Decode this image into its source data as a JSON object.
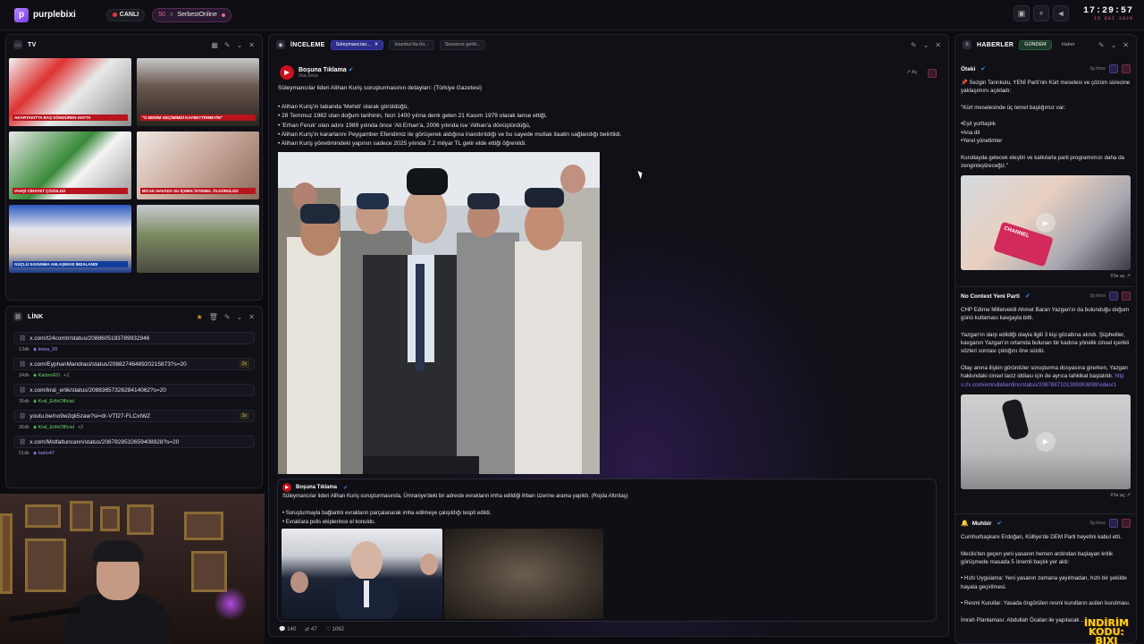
{
  "topbar": {
    "logo_letter": "p",
    "app_name": "purplebixi",
    "live_label": "CANLI",
    "viewer_count": "50",
    "user_status": "SerbestOnline",
    "clock_time": "17:29:57",
    "clock_date": "15 EKİ 2026"
  },
  "tv_panel": {
    "title": "TV",
    "tiles": [
      {
        "caption": "AKARYAKITTA BAŞ DÖNDÜREN HAFTA",
        "tone": "red"
      },
      {
        "caption": "\"O BENİM GEÇİMİMDİ KAYBETTİRMEYİN\"",
        "tone": "red"
      },
      {
        "caption": "VAHŞİ CİNAYET ÇÖZÜLDÜ",
        "tone": "red"
      },
      {
        "caption": "BİCAK HAVADA SU İÇMEK İSTEMEL ÖLDÜRÜLDÜ",
        "tone": "red"
      },
      {
        "caption": "GÜÇLÜ SAVUNMA ANLAŞMASI İMZALANDI",
        "tone": "blue"
      },
      {
        "caption": "",
        "tone": "none"
      }
    ]
  },
  "link_panel": {
    "title": "LİNK",
    "items": [
      {
        "url": "x.com/t24comtr/status/2088605183789932946",
        "age": "13dk",
        "user": "leiwa_00",
        "extra": "",
        "badge": ""
      },
      {
        "url": "x.com/EyphanMandraci/status/2088274648920215873?s=20",
        "age": "34dk",
        "user": "KaizenED",
        "extra": "+2",
        "badge": "2x"
      },
      {
        "url": "x.com/kral_erlik/status/2088365732628414062?s=20",
        "age": "35dk",
        "user": "Kral_ErlikOfficial",
        "extra": "",
        "badge": ""
      },
      {
        "url": "youtu.be/no9w2qk5zaw?si=dr-VTf27-FLCxIWZ",
        "age": "36dk",
        "user": "Kral_ErlikOfficial",
        "extra": "+2",
        "badge": "2x"
      },
      {
        "url": "x.com/Mstfaltuncann/status/2087828532659408928?s=20",
        "age": "51dk",
        "user": "baho47",
        "extra": "",
        "badge": ""
      }
    ]
  },
  "inceleme_panel": {
    "title": "İNCELEME",
    "tabs": [
      {
        "label": "Süleymancılar...",
        "active": true
      },
      {
        "label": "İstanbul'da bir...",
        "active": false
      },
      {
        "label": "Sessizce geldi...",
        "active": false
      }
    ],
    "post": {
      "author": "Boşuna Tıklama",
      "time": "3sa önce",
      "open_label": "Aç",
      "text": "Süleymancılar lideri Alihan Kuriş soruşturmasının detayları: (Türkiye Gazetesi)\n\n• Alihan Kuriş'in tabanda 'Mehdi' olarak görüldüğü,\n• 28 Temmuz 1982 olan doğum tarihinin, hicri 1400 yılına denk gelen 21 Kasım 1979 olarak lanse ettiği,\n• 'Erhan Feruk' olan adını 1989 yılında önce 'Ali Erhan'a, 2006 yılında ise 'Alihan'a dönüştürdüğü,\n• Alihan Kuriş'in kararlarını Peygamber Efendimiz ile görüşerek aldığına inandırıldığı ve bu sayede mutlak itaatin sağlandığı belirtildi.\n• Alihan Kuriş yönetimindeki yapının sadece 2025 yılında 7.2 milyar TL gelir elde ettiği öğrenildi."
    },
    "quote": {
      "author": "Boşuna Tıklama",
      "text": "Süleymancılar lideri Alihan Kuriş soruşturmasında, Ümraniye'deki bir adreste evrakların imha edildiği ihbarı üzerine arama yapıldı. (Rojda Altıntaş)\n\n• Soruşturmayla bağlantılı evrakların parçalanarak imha edilmeye çalışıldığı tespit edildi.\n• Evraklara polis ekiplerince el konuldu."
    },
    "stats": {
      "replies": "140",
      "reposts": "47",
      "likes": "1062"
    }
  },
  "haberler_panel": {
    "title": "HABERLER",
    "tabs": [
      {
        "label": "GÜNDEM",
        "active": true
      },
      {
        "label": "Haber",
        "active": false
      }
    ],
    "items": [
      {
        "author": "Öteki",
        "ago": "3g önce",
        "text": "📌 Sezgin Tanrıkulu, YENİ Parti'nin Kürt meselesi ve çözüm sürecine yaklaşımını açıkladı:\n\n\"Kürt meselesinde üç temel başlığımız var:\n\n•Eşit yurttaşlık\n•Ana dil\n•Yerel yönetimler\n\nKurultayda gelecek eleştiri ve katkılarla parti programımızı daha da zenginleştireceğiz.\"",
        "xlink": "X'te aç ↗",
        "media_label": "CHANNEL"
      },
      {
        "author": "No Context Yeni Parti",
        "ago": "3g önce",
        "text": "CHP Edirne Milletvekili Ahmet Baran Yazgan'ın da bulunduğu doğum günü kutlaması kavgayla bitti.\n\nYazgan'ın darp edildiği olayla ilgili 3 kişi gözaltına alındı. Şüpheliler, kavganın Yazgan'ın ortamda bulunan bir kadına yönelik cinsel içerikli sözleri sonrası çıktığını öne sürdü.\n\nOlay anına ilişkin görüntüler soruşturma dosyasına girerken, Yazgan hakkındaki cinsel taciz iddiası için de ayrıca tahkikat başlatıldı.",
        "link": "https://x.com/emrullaherdinc/status/2087887101308063898/video/1",
        "xlink": "X'te aç ↗"
      },
      {
        "author": "Muhbir",
        "ago": "3g önce",
        "text": "Cumhurbaşkanı Erdoğan, Külliye'de DEM Parti heyetini kabul etti.\n\nMeclis'ten geçen yeni yasanın hemen ardından başlayan kritik görüşmede masada 5 önemli başlık yer aldı:\n\n• Hızlı Uygulama: Yeni yasanın zamana yayılmadan, hızlı bir şekilde hayata geçirilmesi.\n\n• Resmi Kurullar: Yasada öngörülen resmi kurulların acilen kurulması.\n\nİmrah Planlaması: Abdullah Öcalan ile yapılacak ..."
      }
    ]
  },
  "promo": {
    "line1": "İNDİRİM KODU:",
    "line2": "BIXI"
  }
}
